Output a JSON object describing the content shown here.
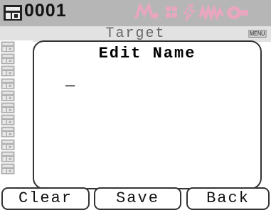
{
  "header": {
    "id": "0001",
    "status_icons": [
      "auto-status-icon",
      "grid-icon",
      "lightning-icon",
      "waveform-icon",
      "lens-icon"
    ]
  },
  "subtitle": {
    "text": "Target",
    "menu": "MENU"
  },
  "panel": {
    "title": "Edit Name",
    "input_value": "_"
  },
  "softkeys": {
    "clear": "Clear",
    "save": "Save",
    "back": "Back"
  },
  "colors": {
    "header_bg": "#b6b6b6",
    "subtitle_bg": "#e2e2e2",
    "status_icon_pink": "#e9a6bf"
  }
}
